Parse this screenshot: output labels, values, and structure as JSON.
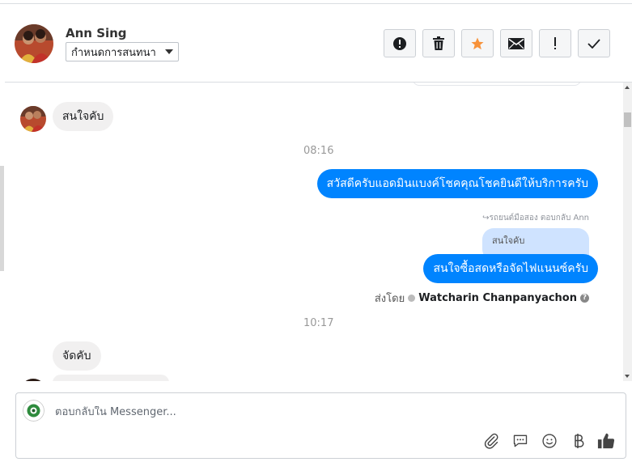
{
  "header": {
    "contact_name": "Ann Sing",
    "assign_label": "กำหนดการสนทนา",
    "toolbar": [
      {
        "name": "spam-report-button",
        "icon": "alert-circle-icon"
      },
      {
        "name": "delete-button",
        "icon": "trash-icon"
      },
      {
        "name": "star-button",
        "icon": "star-icon"
      },
      {
        "name": "mark-unread-button",
        "icon": "envelope-icon"
      },
      {
        "name": "follow-up-button",
        "icon": "exclamation-icon"
      },
      {
        "name": "mark-done-button",
        "icon": "check-icon"
      }
    ]
  },
  "messages": {
    "m1": "สนใจคับ",
    "t1": "08:16",
    "m2": "สวัสดีครับแอดมินแบงค์โชคคุณโชคยินดีให้บริการครับ",
    "reply_note": "↪รถยนต์มือสอง ตอบกลับ Ann",
    "quoted": "สนใจคับ",
    "m3": "สนใจซื้อสดหรือจัดไฟแนนซ์ครับ",
    "sent_by_label": "ส่งโดย",
    "agent": "Watcharin Chanpanyachon",
    "t2": "10:17",
    "m4": "จัดคับ"
  },
  "composer": {
    "placeholder": "ตอบกลับใน Messenger..."
  },
  "colors": {
    "outgoing": "#0084ff",
    "incoming": "#f1f0f0",
    "star": "#f7923a"
  }
}
